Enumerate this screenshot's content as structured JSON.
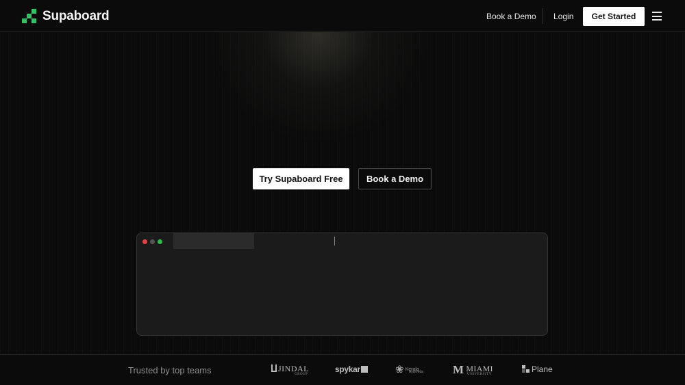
{
  "brand": {
    "name": "Supaboard",
    "accent_color": "#34c163",
    "logo_icon": "pixel-stairs-icon"
  },
  "nav": {
    "book_demo": "Book a Demo",
    "login": "Login",
    "get_started": "Get Started",
    "menu_icon": "hamburger-menu-icon"
  },
  "hero": {
    "primary_cta": "Try Supaboard Free",
    "secondary_cta": "Book a Demo"
  },
  "window": {
    "controls": [
      "close",
      "minimize",
      "maximize"
    ],
    "control_colors": [
      "#e0443e",
      "#555555",
      "#2dbb4a"
    ]
  },
  "trusted": {
    "label": "Trusted by top teams",
    "logos": [
      {
        "name": "JINDAL",
        "sub": "GROUP"
      },
      {
        "name": "spykar"
      },
      {
        "name": "Kerala",
        "sub": "Ayurveda"
      },
      {
        "name": "MIAMI",
        "sub": "UNIVERSITY"
      },
      {
        "name": "Plane"
      }
    ]
  }
}
